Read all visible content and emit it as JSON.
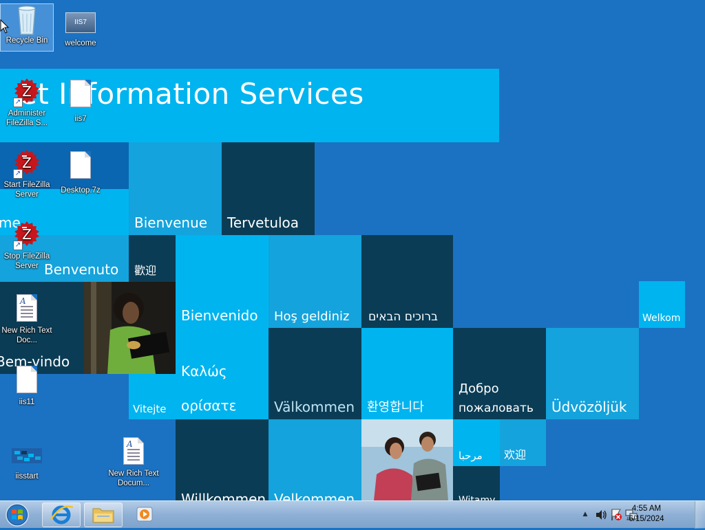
{
  "desktop": {
    "banner_text": "et Information Services",
    "tiles": {
      "bienvenue": "Bienvenue",
      "tervetuloa": "Tervetuloa",
      "me": "me",
      "benvenuto": "Benvenuto",
      "huanying_tw": "歡迎",
      "bienvenido": "Bienvenido",
      "hos_geldiniz": "Hoş geldiniz",
      "hebrew": "ברוכים הבאים",
      "welkom": "Welkom",
      "bem_vindo": "Bem-vindo",
      "kalos_line1": "Καλώς",
      "kalos_line2": "ορίσατε",
      "valkommen": "Välkommen",
      "korean": "환영합니다",
      "dobro_line1": "Добро",
      "dobro_line2": "пожаловать",
      "udvozoljuk": "Üdvözöljük",
      "vitejte": "Vitejte",
      "arabic": "مرحبا",
      "huanying_cn": "欢迎",
      "willkommen": "Willkommen",
      "velkommen": "Velkommen",
      "witamy": "Witamy"
    }
  },
  "icons": [
    {
      "label": "Recycle Bin"
    },
    {
      "label": "welcome"
    },
    {
      "label": "Administer FileZilla S..."
    },
    {
      "label": "iis7"
    },
    {
      "label": "Start FileZilla Server"
    },
    {
      "label": "Desktop.7z"
    },
    {
      "label": "Stop FileZilla Server"
    },
    {
      "label": "New Rich Text Doc..."
    },
    {
      "label": "iis11"
    },
    {
      "label": "iisstart"
    },
    {
      "label": "New Rich Text Docum..."
    }
  ],
  "welcome_icon_text": "IIS7",
  "taskbar": {
    "time": "4:55 AM",
    "date": "6/15/2024"
  }
}
